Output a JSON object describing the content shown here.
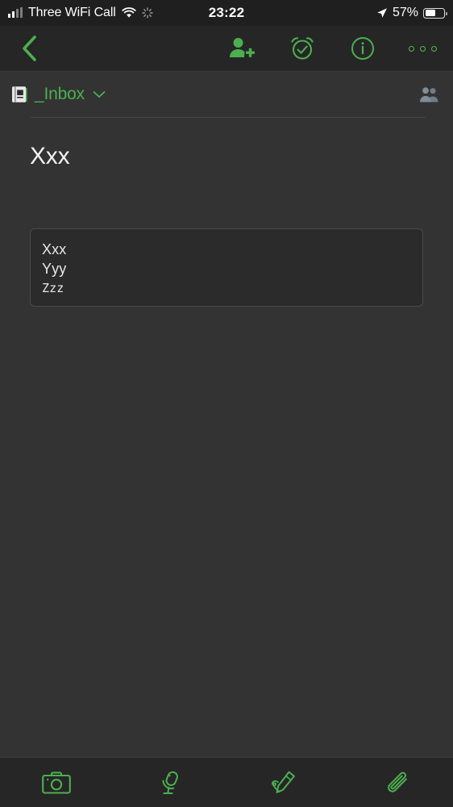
{
  "status_bar": {
    "carrier": "Three WiFi Call",
    "time": "23:22",
    "battery_percent": "57%",
    "battery_level": 57,
    "signal_icon": "signal-bars-icon",
    "wifi_icon": "wifi-icon",
    "activity_icon": "activity-spinner-icon",
    "location_icon": "location-arrow-icon",
    "battery_icon": "battery-icon"
  },
  "nav_bar": {
    "back_icon": "chevron-left-icon",
    "actions": [
      {
        "name": "add-person-button",
        "icon": "add-person-icon",
        "label": "Add person"
      },
      {
        "name": "reminder-button",
        "icon": "alarm-check-icon",
        "label": "Reminder"
      },
      {
        "name": "info-button",
        "icon": "info-circle-icon",
        "label": "Info"
      },
      {
        "name": "more-button",
        "icon": "more-dots-icon",
        "label": "More"
      }
    ],
    "accent_color": "#4caf50"
  },
  "notebook_header": {
    "book_icon": "notebook-icon",
    "notebook_name": "_Inbox",
    "chevron_icon": "chevron-down-icon",
    "share_icon": "people-group-icon"
  },
  "note": {
    "title": "Xxx",
    "card_lines": [
      {
        "text": "Xxx",
        "style": "sans"
      },
      {
        "text": "Yyy",
        "style": "sans"
      },
      {
        "text": "Zzz",
        "style": "mono"
      }
    ]
  },
  "toolbar": {
    "items": [
      {
        "name": "camera-button",
        "icon": "camera-icon",
        "label": "Camera"
      },
      {
        "name": "audio-button",
        "icon": "microphone-icon",
        "label": "Audio"
      },
      {
        "name": "sketch-button",
        "icon": "pen-sketch-icon",
        "label": "Sketch"
      },
      {
        "name": "attachment-button",
        "icon": "paperclip-icon",
        "label": "Attach"
      }
    ],
    "accent_color": "#4caf50"
  },
  "colors": {
    "background": "#333333",
    "bar_background": "#262626",
    "status_background": "#1f1f1f",
    "accent": "#4caf50",
    "card_background": "#2b2b2b",
    "card_border": "#4a4a4a",
    "text_primary": "#f2f2f2",
    "icon_muted": "#7f8c99"
  }
}
